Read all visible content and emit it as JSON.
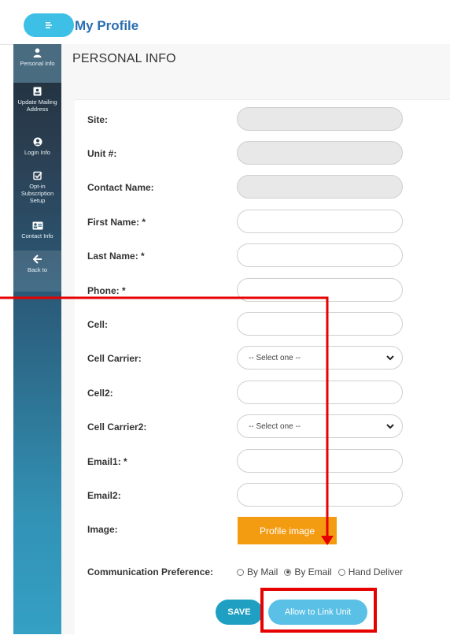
{
  "header": {
    "title": "My Profile"
  },
  "sidebar": {
    "items": [
      {
        "label": "Personal Info",
        "icon": "person-icon"
      },
      {
        "label": "Update Mailing Address",
        "icon": "address-card-icon"
      },
      {
        "label": "Login Info",
        "icon": "user-circle-icon"
      },
      {
        "label": "Opt-in Subscription Setup",
        "icon": "checkbox-icon"
      },
      {
        "label": "Contact Info",
        "icon": "contact-card-icon"
      },
      {
        "label": "Back to",
        "icon": "arrow-left-icon"
      }
    ]
  },
  "main": {
    "section_title": "PERSONAL INFO",
    "fields": {
      "site": {
        "label": "Site:",
        "value": ""
      },
      "unit": {
        "label": "Unit #:",
        "value": ""
      },
      "contact_name": {
        "label": "Contact Name:",
        "value": ""
      },
      "first_name": {
        "label": "First Name: *",
        "value": ""
      },
      "last_name": {
        "label": "Last Name: *",
        "value": ""
      },
      "phone": {
        "label": "Phone: *",
        "value": ""
      },
      "cell": {
        "label": "Cell:",
        "value": ""
      },
      "cell_carrier": {
        "label": "Cell Carrier:",
        "selected": "-- Select one --"
      },
      "cell2": {
        "label": "Cell2:",
        "value": ""
      },
      "cell_carrier2": {
        "label": "Cell Carrier2:",
        "selected": "-- Select one --"
      },
      "email1": {
        "label": "Email1: *",
        "value": ""
      },
      "email2": {
        "label": "Email2:",
        "value": ""
      },
      "image": {
        "label": "Image:",
        "button": "Profile image"
      }
    },
    "communication": {
      "label": "Communication Preference:",
      "options": [
        "By Mail",
        "By Email",
        "Hand Deliver"
      ],
      "selected": "By Email"
    },
    "buttons": {
      "save": "SAVE",
      "link_unit": "Allow to Link Unit"
    }
  },
  "colors": {
    "accent": "#3dbfe6",
    "title": "#2a6fb0",
    "save_button": "#1f9fc2",
    "link_button": "#5bc0e6",
    "image_button": "#f39c12",
    "annotation": "#e60000"
  }
}
